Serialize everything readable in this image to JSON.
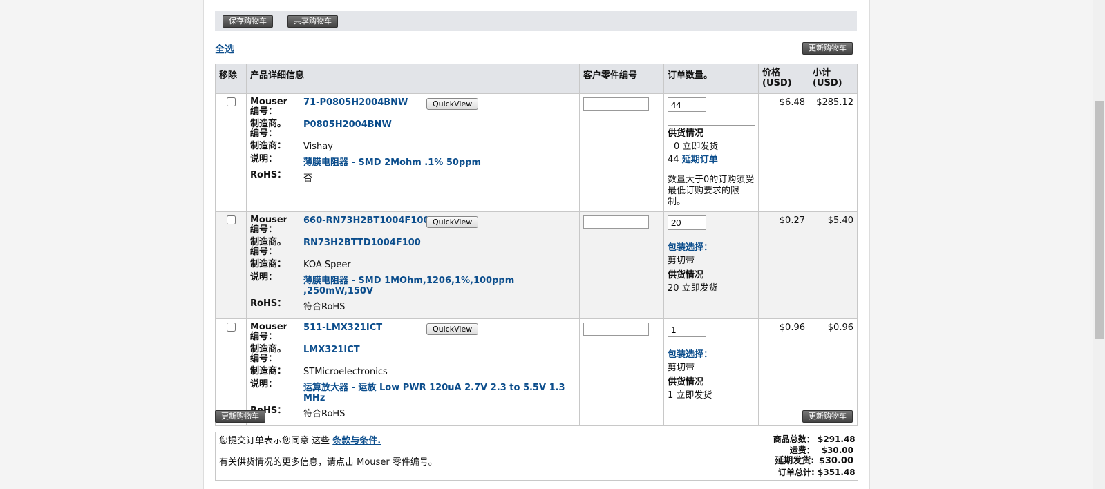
{
  "toolbar": {
    "save_cart": "保存购物车",
    "share_cart": "共享购物车",
    "update_cart": "更新购物车"
  },
  "select_all": "全选",
  "columns": {
    "remove": "移除",
    "details": "产品详细信息",
    "customer_part": "客户零件编号",
    "qty": "订单数量。",
    "price": "价格\n(USD)",
    "subtotal": "小计\n(USD)"
  },
  "labels": {
    "mouser_no": "Mouser\n编号：",
    "mfr_no": "制造商。\n编号：",
    "mfr": "制造商：",
    "desc": "说明：",
    "rohs": "RoHS：",
    "quickview": "QuickView",
    "availability": "供货情况",
    "packaging": "包装选择："
  },
  "items": [
    {
      "mouser_no": "71-P0805H2004BNW",
      "mfr_no": "P0805H2004BNW",
      "mfr": "Vishay",
      "desc": "薄膜电阻器 - SMD 2Mohm .1% 50ppm",
      "rohs": "否",
      "qty": "44",
      "packaging": "",
      "price": "$6.48",
      "subtotal": "$285.12",
      "stock_line1": "0 立即发货",
      "stock_line2_num": "44",
      "stock_line2_link": "延期订单",
      "note": "数量大于0的订购须受最低订购要求的限制。"
    },
    {
      "mouser_no": "660-RN73H2BT1004F100",
      "mfr_no": "RN73H2BTTD1004F100",
      "mfr": "KOA Speer",
      "desc": "薄膜电阻器 - SMD 1MOhm,1206,1%,100ppm ,250mW,150V",
      "rohs": "符合RoHS",
      "qty": "20",
      "packaging": "剪切带",
      "price": "$0.27",
      "subtotal": "$5.40",
      "stock_line1": "20 立即发货"
    },
    {
      "mouser_no": "511-LMX321ICT",
      "mfr_no": "LMX321ICT",
      "mfr": "STMicroelectronics",
      "desc": "运算放大器 - 运放 Low PWR 120uA 2.7V 2.3 to 5.5V 1.3 MHz",
      "rohs": "符合RoHS",
      "qty": "1",
      "packaging": "剪切带",
      "price": "$0.96",
      "subtotal": "$0.96",
      "stock_line1": "1 立即发货"
    }
  ],
  "footer": {
    "terms_prefix": "您提交订单表示您同意 这些 ",
    "terms_link": "条款与条件.",
    "info": "有关供货情况的更多信息，请点击 Mouser 零件编号。",
    "summary": [
      {
        "label": "商品总数：",
        "value": "$291.48"
      },
      {
        "label": "运费：",
        "value": "$30.00"
      },
      {
        "label": "延期发货:",
        "value": "$30.00"
      },
      {
        "label": "订单总计:",
        "value": "$351.48"
      }
    ]
  }
}
